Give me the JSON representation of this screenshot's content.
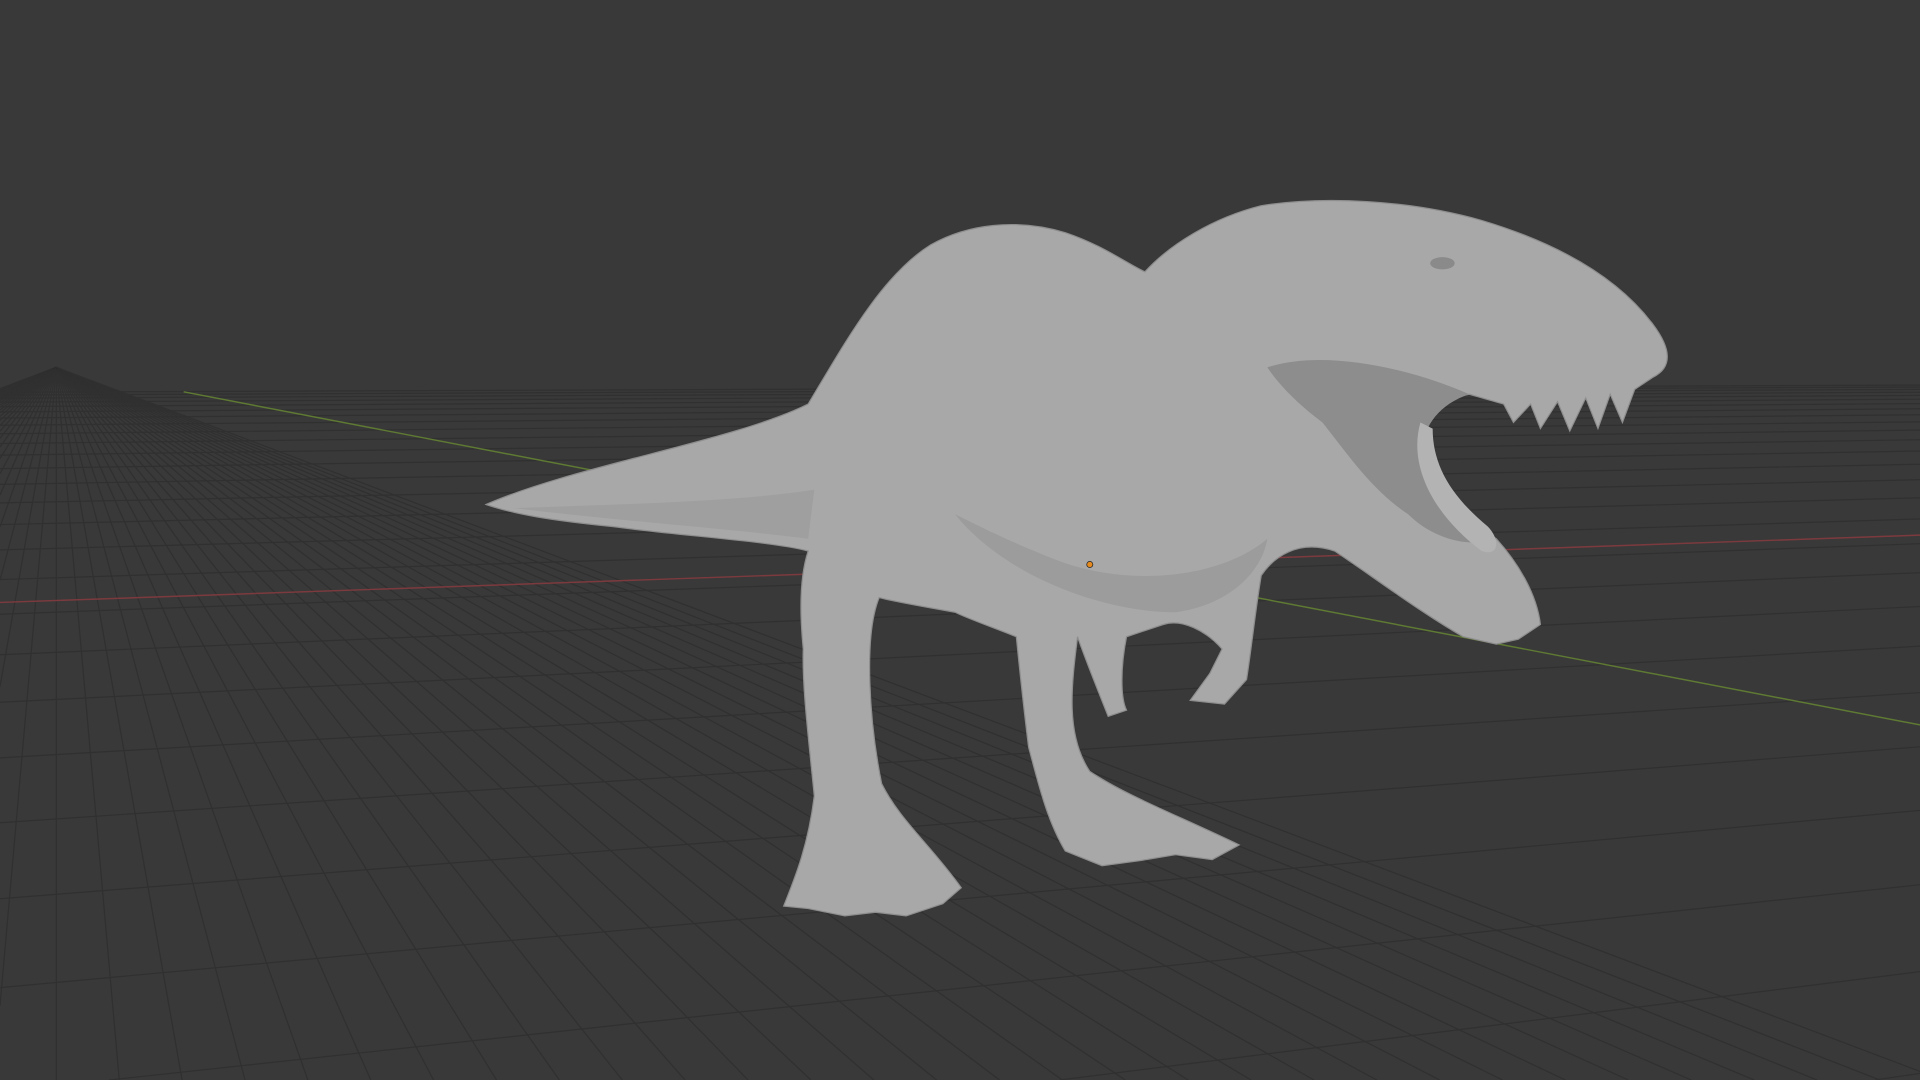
{
  "viewport": {
    "view": "3d-viewport",
    "background_color": "#393939",
    "grid_color": "#2f2f2f",
    "x_axis_color": "#8a3a3f",
    "y_axis_color": "#6b8a33",
    "model_color": "#a9a9a9",
    "origin_color": "#e58a1f"
  }
}
